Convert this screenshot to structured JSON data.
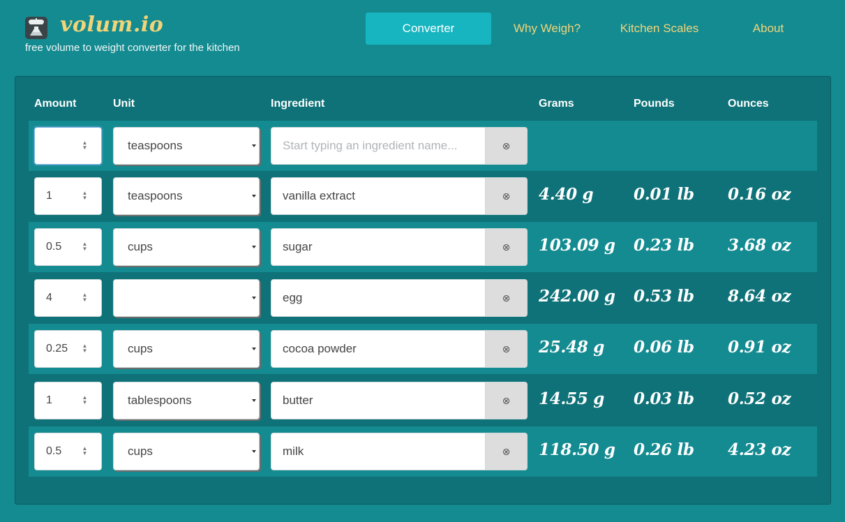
{
  "header": {
    "brand": "volum.io",
    "tagline": "free volume to weight converter for the kitchen",
    "logo_icon": "scale-flask-icon"
  },
  "nav": [
    {
      "label": "Converter",
      "active": true
    },
    {
      "label": "Why Weigh?",
      "active": false
    },
    {
      "label": "Kitchen Scales",
      "active": false
    },
    {
      "label": "About",
      "active": false
    }
  ],
  "columns": {
    "amount": "Amount",
    "unit": "Unit",
    "ingredient": "Ingredient",
    "grams": "Grams",
    "pounds": "Pounds",
    "ounces": "Ounces"
  },
  "rows": [
    {
      "amount": "",
      "unit": "teaspoons",
      "ingredient": "",
      "ingredient_placeholder": "Start typing an ingredient name...",
      "grams": "",
      "pounds": "",
      "ounces": ""
    },
    {
      "amount": "1",
      "unit": "teaspoons",
      "ingredient": "vanilla extract",
      "grams": "4.40 g",
      "pounds": "0.01 lb",
      "ounces": "0.16 oz"
    },
    {
      "amount": "0.5",
      "unit": "cups",
      "ingredient": "sugar",
      "grams": "103.09 g",
      "pounds": "0.23 lb",
      "ounces": "3.68 oz"
    },
    {
      "amount": "4",
      "unit": "",
      "ingredient": "egg",
      "grams": "242.00 g",
      "pounds": "0.53 lb",
      "ounces": "8.64 oz"
    },
    {
      "amount": "0.25",
      "unit": "cups",
      "ingredient": "cocoa powder",
      "grams": "25.48 g",
      "pounds": "0.06 lb",
      "ounces": "0.91 oz"
    },
    {
      "amount": "1",
      "unit": "tablespoons",
      "ingredient": "butter",
      "grams": "14.55 g",
      "pounds": "0.03 lb",
      "ounces": "0.52 oz"
    },
    {
      "amount": "0.5",
      "unit": "cups",
      "ingredient": "milk",
      "grams": "118.50 g",
      "pounds": "0.26 lb",
      "ounces": "4.23 oz"
    }
  ],
  "icons": {
    "clear": "circle-x-icon",
    "spinner": "spinner-arrows-icon",
    "dropdown": "caret-down-icon"
  },
  "colors": {
    "background": "#138b91",
    "panel": "#0e7278",
    "accent": "#16b5c0",
    "brand": "#f2d479"
  }
}
